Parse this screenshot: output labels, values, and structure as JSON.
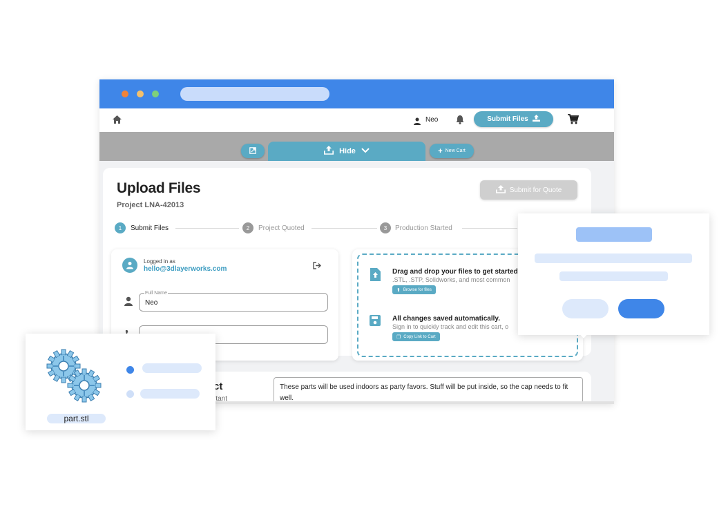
{
  "nav": {
    "user_name": "Neo",
    "submit_files_label": "Submit Files"
  },
  "toolbar": {
    "hide_label": "Hide",
    "new_cart_label": "New Cart"
  },
  "page": {
    "title": "Upload Files",
    "project": "Project LNA-42013",
    "submit_quote_label": "Submit for Quote"
  },
  "steps": [
    {
      "num": "1",
      "label": "Submit Files"
    },
    {
      "num": "2",
      "label": "Project Quoted"
    },
    {
      "num": "3",
      "label": "Production Started"
    }
  ],
  "account": {
    "logged_in_label": "Logged in as",
    "email": "hello@3dlayerworks.com",
    "full_name_label": "Full Name",
    "full_name_value": "Neo"
  },
  "dropzone": {
    "title": "Drag and drop your files to get started",
    "formats": ".STL, .STP, Solidworks, and most common",
    "browse_label": "Browse for files",
    "saved_title": "All changes saved automatically.",
    "saved_sub": "Sign in to quickly track and edit this cart, o",
    "copy_link_label": "Copy Link to Cart"
  },
  "notes": {
    "heading_fragment": "ct",
    "sub_fragment": "rtant",
    "text": "These parts will be used indoors as party favors. Stuff will be put inside, so the cap needs to fit well."
  },
  "file_card": {
    "filename": "part.stl"
  },
  "colors": {
    "accent": "#5aaac4",
    "titlebar": "#3f86e8",
    "skeleton_light": "#dde9fb",
    "skeleton_blue": "#3f86e8"
  }
}
